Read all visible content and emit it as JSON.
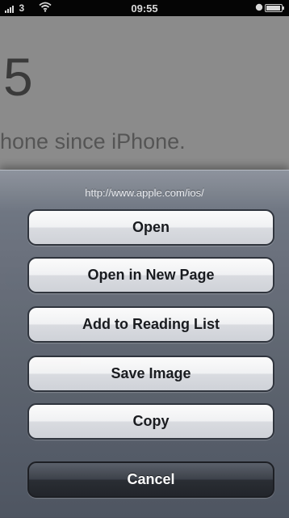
{
  "status_bar": {
    "carrier": "3",
    "time": "09:55"
  },
  "background_page": {
    "headline_number": "5",
    "tagline": "hone since iPhone."
  },
  "action_sheet": {
    "title": "http://www.apple.com/ios/",
    "buttons": [
      {
        "label": "Open"
      },
      {
        "label": "Open in New Page"
      },
      {
        "label": "Add to Reading List"
      },
      {
        "label": "Save Image"
      },
      {
        "label": "Copy"
      }
    ],
    "cancel_label": "Cancel"
  },
  "colors": {
    "sheet_background": "#5d6470",
    "button_light": "#f4f5f7",
    "button_dark": "#272b32"
  }
}
